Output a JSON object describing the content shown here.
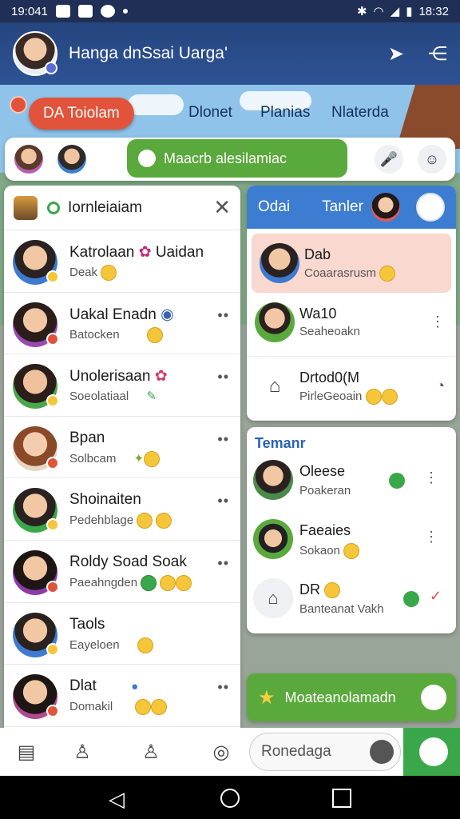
{
  "statusbar": {
    "time_left": "19:041",
    "time_right": "18:32"
  },
  "appbar": {
    "title": "Hanga dnSsai Uarga'"
  },
  "top_tabs": [
    {
      "label": "DA Toiolam"
    },
    {
      "label": "Dlonet"
    },
    {
      "label": "Planias"
    },
    {
      "label": "Nlaterda"
    }
  ],
  "search_strip": {
    "action_label": "Maacrb alesilamiac"
  },
  "left_panel": {
    "title": "Iornleiaiam",
    "chats": [
      {
        "name": "Katrolaan",
        "name_extra": "Uaidan",
        "sub": "Deak"
      },
      {
        "name": "Uakal Enadn",
        "name_extra": "",
        "sub": "Batocken"
      },
      {
        "name": "Unolerisaan",
        "name_extra": "",
        "sub": "Soeolatiaal"
      },
      {
        "name": "Bpan",
        "name_extra": "",
        "sub": "Solbcam"
      },
      {
        "name": "Shoinaiten",
        "name_extra": "",
        "sub": "Pedehblage"
      },
      {
        "name": "Roldy Soad Soak",
        "name_extra": "",
        "sub": "Paeahngden"
      },
      {
        "name": "Taols",
        "name_extra": "",
        "sub": "Eayeloen"
      },
      {
        "name": "Dlat",
        "name_extra": "",
        "sub": "Domakil"
      }
    ]
  },
  "right_top": {
    "tab1": "Odai",
    "tab2": "Tanler",
    "items": [
      {
        "name": "Dab",
        "sub": "Coaarasrusm"
      },
      {
        "name": "Wa10",
        "sub": "Seaheoakn"
      },
      {
        "name": "Drtod0(M",
        "sub": "PirleGeoain"
      }
    ]
  },
  "right_mid": {
    "title": "Temanr",
    "items": [
      {
        "name": "Oleese",
        "sub": "Poakeran"
      },
      {
        "name": "Faeaies",
        "sub": "Sokaon"
      },
      {
        "name": "DR",
        "sub": "Banteanat Vakh"
      }
    ]
  },
  "cta": {
    "label": "Moateanolamadn"
  },
  "composer": {
    "placeholder": "Ronedaga"
  }
}
